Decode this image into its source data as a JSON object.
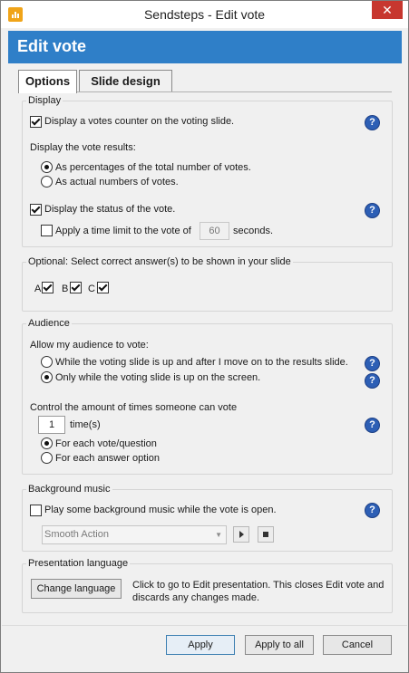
{
  "window": {
    "title": "Sendsteps - Edit vote",
    "close_glyph": "✕"
  },
  "banner": {
    "title": "Edit vote"
  },
  "tabs": [
    {
      "label": "Options"
    },
    {
      "label": "Slide design"
    }
  ],
  "display": {
    "group_title": "Display",
    "counter_label": "Display a votes counter on the voting slide.",
    "counter_checked": true,
    "results_label": "Display the vote results:",
    "results_options": [
      {
        "label": "As percentages of the total number of votes.",
        "checked": true
      },
      {
        "label": "As actual numbers of votes.",
        "checked": false
      }
    ],
    "status_label": "Display the status of the vote.",
    "status_checked": true,
    "timelimit_label": "Apply a time limit to the vote of",
    "timelimit_checked": false,
    "timelimit_value": "60",
    "timelimit_unit": "seconds."
  },
  "optional": {
    "group_title": "Optional: Select correct answer(s) to be shown in your slide",
    "answers": [
      {
        "label": "A",
        "checked": true
      },
      {
        "label": "B",
        "checked": true
      },
      {
        "label": "C",
        "checked": true
      }
    ]
  },
  "audience": {
    "group_title": "Audience",
    "allow_label": "Allow my audience to vote:",
    "allow_options": [
      {
        "label": "While the voting slide is up and after I move on to the results slide.",
        "checked": false
      },
      {
        "label": "Only while the voting slide is up on the screen.",
        "checked": true
      }
    ],
    "control_label": "Control the amount of times someone can vote",
    "times_value": "1",
    "times_unit": "time(s)",
    "per_options": [
      {
        "label": "For each vote/question",
        "checked": true
      },
      {
        "label": "For each answer option",
        "checked": false
      }
    ]
  },
  "music": {
    "group_title": "Background music",
    "play_label": "Play some background music while the vote is open.",
    "play_checked": false,
    "track": "Smooth Action"
  },
  "language": {
    "group_title": "Presentation language",
    "button_label": "Change language",
    "description": "Click to go to Edit presentation. This closes Edit vote and discards any changes made."
  },
  "footer": {
    "apply": "Apply",
    "apply_all": "Apply to all",
    "cancel": "Cancel"
  },
  "help_glyph": "?",
  "colors": {
    "banner": "#2f7fc8",
    "help": "#2d5fb5",
    "close": "#c7372f",
    "app_icon": "#f0a419"
  }
}
